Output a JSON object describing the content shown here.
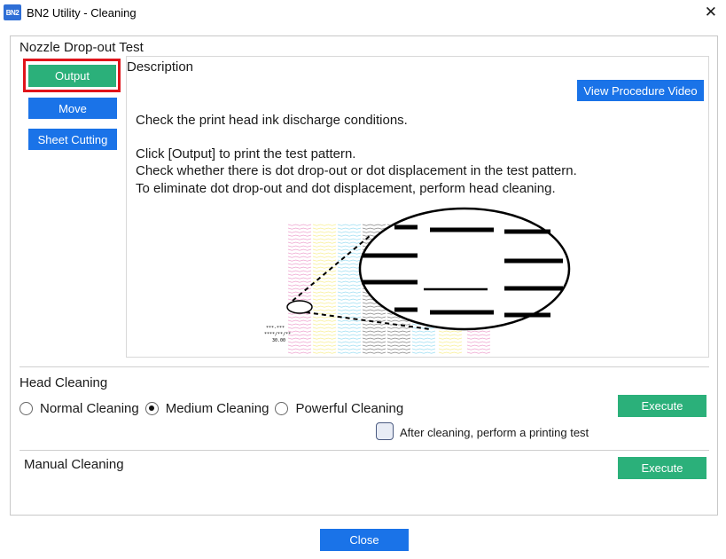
{
  "window": {
    "logo_text": "BN2",
    "title": "BN2 Utility - Cleaning",
    "close_glyph": "✕"
  },
  "nozzle_test": {
    "title": "Nozzle Drop-out Test",
    "output_label": "Output",
    "move_label": "Move",
    "sheet_cutting_label": "Sheet Cutting",
    "description": {
      "heading": "Description",
      "video_button": "View Procedure Video",
      "line1": "Check the print head ink discharge conditions.",
      "line2": "Click [Output] to print the test pattern.",
      "line3": "Check whether there is dot drop-out or dot displacement in the test pattern.",
      "line4": "To eliminate dot drop-out and dot displacement, perform head cleaning.",
      "illustration": {
        "print_info": [
          "***-***",
          "****/**/**",
          "30.00"
        ],
        "ink_colors": [
          "#e05aa8",
          "#f2e23a",
          "#4fc3e8",
          "#222222"
        ]
      }
    }
  },
  "head_cleaning": {
    "title": "Head Cleaning",
    "options": [
      {
        "label": "Normal Cleaning",
        "selected": false
      },
      {
        "label": "Medium Cleaning",
        "selected": true
      },
      {
        "label": "Powerful Cleaning",
        "selected": false
      }
    ],
    "execute_label": "Execute",
    "after_cleaning_label": "After cleaning, perform a printing test",
    "after_cleaning_checked": false
  },
  "manual_cleaning": {
    "title": "Manual Cleaning",
    "execute_label": "Execute"
  },
  "footer": {
    "close_label": "Close"
  },
  "colors": {
    "blue_button": "#1a73e8",
    "green_button": "#2bb07a",
    "highlight": "#e0141b"
  }
}
